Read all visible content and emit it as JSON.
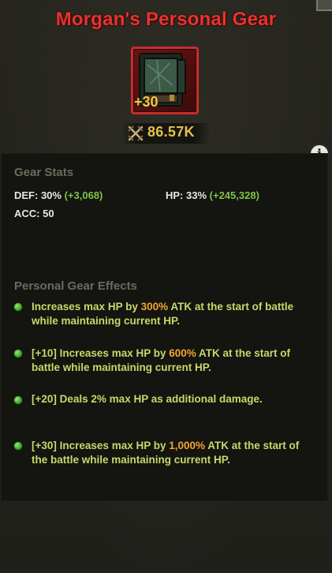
{
  "title": "Morgan's Personal Gear",
  "gear": {
    "upgrade_level": "+30",
    "power": "86.57K"
  },
  "colors": {
    "title": "#e8332f",
    "accent_gold": "#e6c04a",
    "bonus_green": "#7fc34b",
    "effect_text": "#c8d86a",
    "highlight": "#f0a530",
    "frame_red": "#c92c2c"
  },
  "gear_stats": {
    "heading": "Gear Stats",
    "def_label": "DEF: 30%",
    "def_bonus": "(+3,068)",
    "hp_label": "HP: 33%",
    "hp_bonus": "(+245,328)",
    "acc_label": "ACC: 50"
  },
  "effects": {
    "heading": "Personal Gear Effects",
    "items": [
      {
        "before": "Increases max HP by ",
        "value": "300%",
        "after": " ATK at the start of battle while maintaining current HP."
      },
      {
        "before": "[+10] Increases max HP by ",
        "value": "600%",
        "after": " ATK at the start of battle while maintaining current HP."
      },
      {
        "before": "[+20] Deals 2% max HP as additional damage.",
        "value": "",
        "after": ""
      },
      {
        "before": "[+30] Increases max HP by ",
        "value": "1,000%",
        "after": " ATK at the start of the battle while maintaining current HP."
      }
    ]
  },
  "icons": {
    "info": "i",
    "power": "crossed-swords-icon",
    "gear": "backpack-icon"
  }
}
